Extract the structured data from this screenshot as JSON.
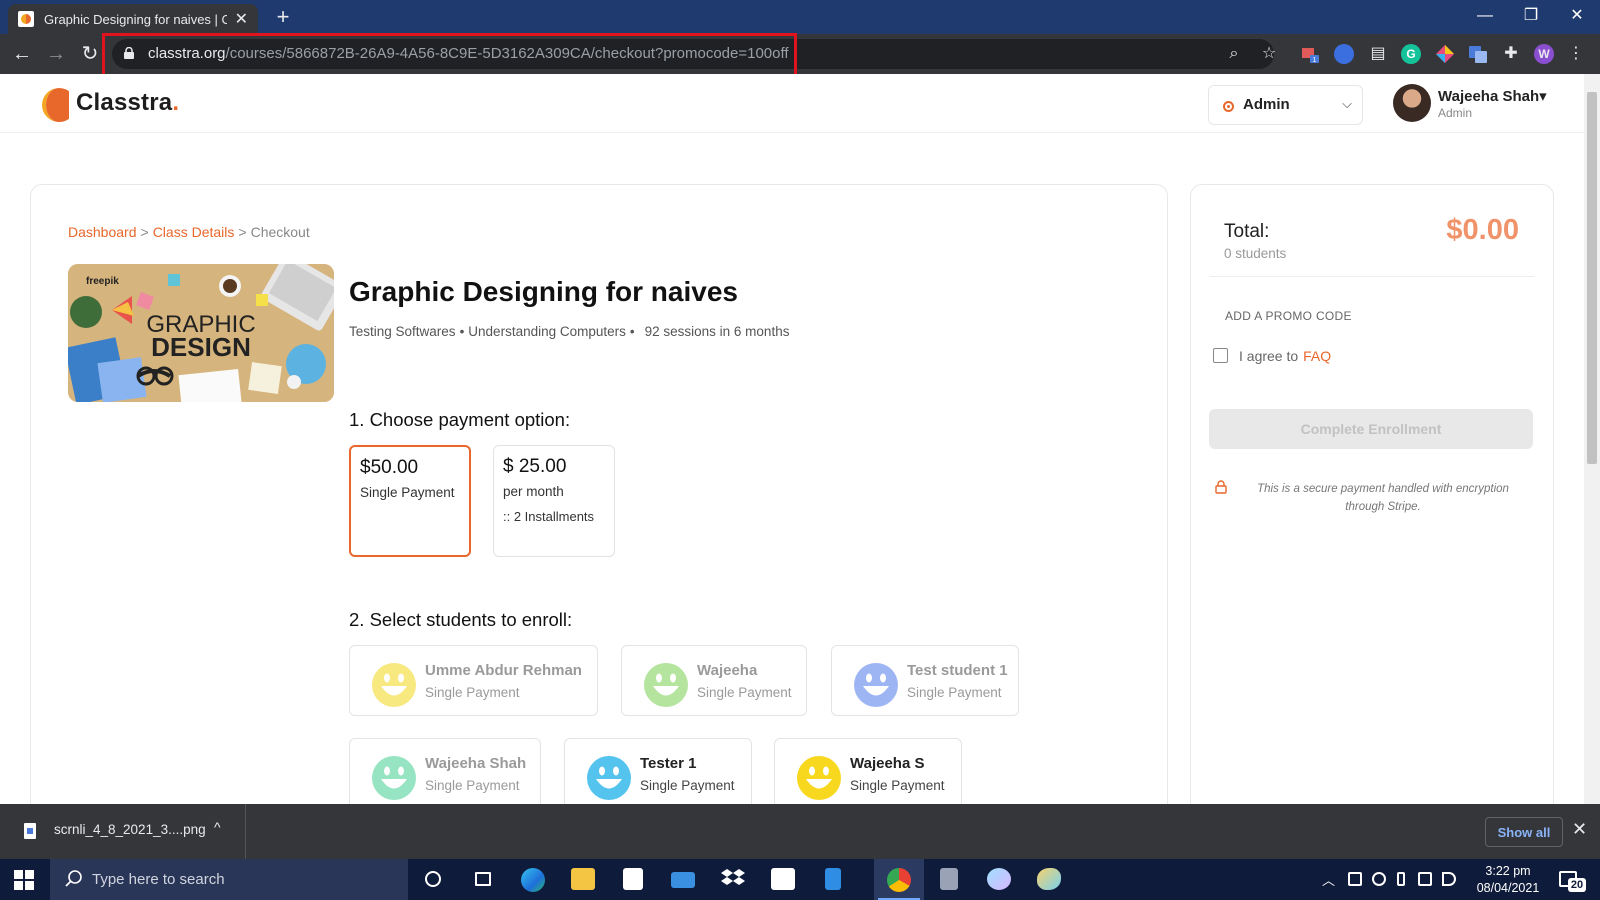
{
  "browser": {
    "tab_title": "Graphic Designing for naives | Cl",
    "new_tab": "+",
    "url_host": "classtra.org",
    "url_path": "/courses/5866872B-26A9-4A56-8C9E-5D3162A309CA/checkout?promocode=100off",
    "extension_profile_initial": "W",
    "ext_badge": "1",
    "highlight_color": "#e0141e"
  },
  "header": {
    "logo_text": "Classtra",
    "logo_dot": ".",
    "role_selected": "Admin",
    "user_name": "Wajeeha Shah▾",
    "user_role": "Admin"
  },
  "breadcrumb": {
    "items": [
      "Dashboard",
      "Class Details",
      "Checkout"
    ],
    "separator": ">"
  },
  "course": {
    "image_text_brand": "freepik",
    "image_text_line1": "GRAPHIC",
    "image_text_line2": "DESIGN",
    "title": "Graphic Designing for naives",
    "category1": "Testing Softwares",
    "category2": "Understanding Computers",
    "bullet": "•",
    "sessions": "92 sessions in 6 months"
  },
  "payment": {
    "heading": "1. Choose payment option:",
    "options": [
      {
        "price": "$50.00",
        "label": "Single Payment",
        "note": "",
        "selected": true
      },
      {
        "price": "$ 25.00",
        "label": "per month",
        "note": ":: 2 Installments",
        "selected": false
      }
    ]
  },
  "students": {
    "heading": "2. Select students to enroll:",
    "list": [
      {
        "name": "Umme Abdur Rehman",
        "plan": "Single Payment",
        "color": "#f6e56b",
        "dimmed": true
      },
      {
        "name": "Wajeeha",
        "plan": "Single Payment",
        "color": "#a8e08e",
        "dimmed": true
      },
      {
        "name": "Test student 1",
        "plan": "Single Payment",
        "color": "#8ea9f3",
        "dimmed": true
      },
      {
        "name": "Wajeeha Shah",
        "plan": "Single Payment",
        "color": "#86e0b8",
        "dimmed": true
      },
      {
        "name": "Tester 1",
        "plan": "Single Payment",
        "color": "#54c3ee",
        "dimmed": false
      },
      {
        "name": "Wajeeha S",
        "plan": "Single Payment",
        "color": "#f8d81f",
        "dimmed": false
      }
    ]
  },
  "summary": {
    "total_label": "Total:",
    "total_students": "0 students",
    "total_amount": "$0.00",
    "promo_link": "ADD A PROMO CODE",
    "agree_text": "I agree to",
    "agree_link": "FAQ",
    "agree_checked": false,
    "enroll_button": "Complete Enrollment",
    "secure_note": "This is a secure payment handled with encryption through Stripe.",
    "accent_color": "#e8672b"
  },
  "downloads": {
    "file_name": "scrnli_4_8_2021_3....png",
    "show_all": "Show all"
  },
  "taskbar": {
    "search_placeholder": "Type here to search",
    "time": "3:22 pm",
    "date": "08/04/2021",
    "notification_count": "20"
  }
}
